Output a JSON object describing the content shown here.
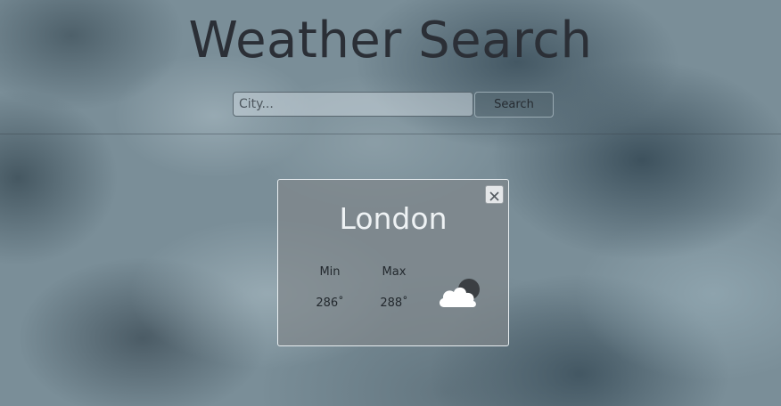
{
  "header": {
    "title": "Weather Search",
    "search": {
      "placeholder": "City...",
      "value": "",
      "button_label": "Search"
    }
  },
  "weather_card": {
    "city": "London",
    "close_label": "×",
    "min_label": "Min",
    "max_label": "Max",
    "min_value": "286˚",
    "max_value": "288˚",
    "icon": "cloud-night-icon"
  },
  "colors": {
    "title": "#2b2f36",
    "card_background": "#80868a",
    "card_border": "#e8eef1",
    "city_text": "#eef2f4"
  }
}
